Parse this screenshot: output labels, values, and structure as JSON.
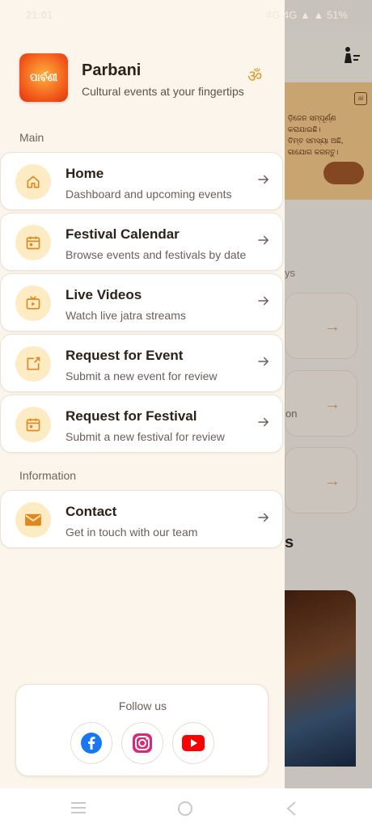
{
  "status_bar": {
    "time": "21:01",
    "right": "4G  4G  ▲  ▲  51%"
  },
  "drawer": {
    "app_name": "Parbani",
    "tagline": "Cultural events at your fingertips",
    "logo_text": "ପାର୍ବଣୀ",
    "om_symbol": "ॐ",
    "sections": {
      "main": "Main",
      "information": "Information"
    },
    "items": [
      {
        "title": "Home",
        "subtitle": "Dashboard and upcoming events",
        "icon": "home-icon"
      },
      {
        "title": "Festival Calendar",
        "subtitle": "Browse events and festivals by date",
        "icon": "calendar-icon"
      },
      {
        "title": "Live Videos",
        "subtitle": "Watch live jatra streams",
        "icon": "live-tv-icon"
      },
      {
        "title": "Request for Event",
        "subtitle": "Submit a new event for review",
        "icon": "share-box-icon"
      },
      {
        "title": "Request for Festival",
        "subtitle": "Submit a new festival for review",
        "icon": "calendar-icon"
      }
    ],
    "info_items": [
      {
        "title": "Contact",
        "subtitle": "Get in touch with our team",
        "icon": "mail-icon"
      }
    ],
    "follow": {
      "title": "Follow us",
      "networks": [
        "facebook-icon",
        "instagram-icon",
        "youtube-icon"
      ]
    }
  },
  "background": {
    "banner_lines": [
      "ଡ଼ିଜେନ ସମ୍ପୂର୍ଣ୍ଣ",
      "କରାଯାଇଛି।",
      "ତିମ୍ବ ସମସ୍ୟା ଅଛି,",
      "ଗାଯୋଗ କରନ୍ତୁ।"
    ],
    "fragment_ys": "ys",
    "fragment_on": "on",
    "fragment_s": "s"
  },
  "colors": {
    "accent": "#e0881f",
    "icon_bg": "#fdebc4",
    "drawer_bg": "#fbf5ec"
  }
}
